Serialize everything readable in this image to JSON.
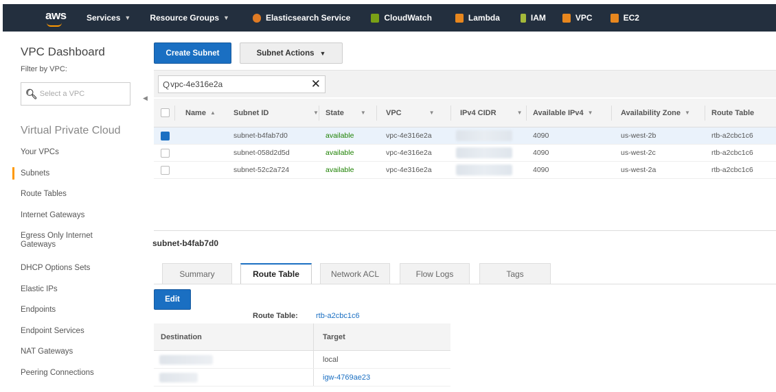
{
  "topnav": {
    "logo": "aws",
    "items": [
      {
        "label": "Services",
        "icon": "none",
        "caret": true
      },
      {
        "label": "Resource Groups",
        "icon": "none",
        "caret": true
      },
      {
        "label": "Elasticsearch Service",
        "icon": "elasticsearch-icon",
        "color": "#e07b24"
      },
      {
        "label": "CloudWatch",
        "icon": "cloudwatch-icon",
        "color": "#7aa116"
      },
      {
        "label": "Lambda",
        "icon": "lambda-icon",
        "color": "#e8871e"
      },
      {
        "label": "IAM",
        "icon": "iam-icon",
        "color": "#a4b93a"
      },
      {
        "label": "VPC",
        "icon": "vpc-icon",
        "color": "#e8871e"
      },
      {
        "label": "EC2",
        "icon": "ec2-icon",
        "color": "#e8871e"
      }
    ]
  },
  "sidebar": {
    "title": "VPC Dashboard",
    "filter_label": "Filter by VPC:",
    "filter_placeholder": "Select a VPC",
    "section_title": "Virtual Private Cloud",
    "items": [
      {
        "label": "Your VPCs"
      },
      {
        "label": "Subnets",
        "active": true
      },
      {
        "label": "Route Tables"
      },
      {
        "label": "Internet Gateways"
      },
      {
        "label": "Egress Only Internet Gateways"
      },
      {
        "label": "DHCP Options Sets"
      },
      {
        "label": "Elastic IPs"
      },
      {
        "label": "Endpoints"
      },
      {
        "label": "Endpoint Services"
      },
      {
        "label": "NAT Gateways"
      },
      {
        "label": "Peering Connections"
      }
    ]
  },
  "toolbar": {
    "create_label": "Create Subnet",
    "actions_label": "Subnet Actions"
  },
  "search": {
    "value": "vpc-4e316e2a"
  },
  "subnets_table": {
    "columns": [
      "Name",
      "Subnet ID",
      "State",
      "VPC",
      "IPv4 CIDR",
      "Available IPv4",
      "Availability Zone",
      "Route Table"
    ],
    "rows": [
      {
        "selected": true,
        "name": "",
        "subnet_id": "subnet-b4fab7d0",
        "state": "available",
        "vpc": "vpc-4e316e2a",
        "available_ipv4": "4090",
        "az": "us-west-2b",
        "route_table": "rtb-a2cbc1c6"
      },
      {
        "selected": false,
        "name": "",
        "subnet_id": "subnet-058d2d5d",
        "state": "available",
        "vpc": "vpc-4e316e2a",
        "available_ipv4": "4090",
        "az": "us-west-2c",
        "route_table": "rtb-a2cbc1c6"
      },
      {
        "selected": false,
        "name": "",
        "subnet_id": "subnet-52c2a724",
        "state": "available",
        "vpc": "vpc-4e316e2a",
        "available_ipv4": "4090",
        "az": "us-west-2a",
        "route_table": "rtb-a2cbc1c6"
      }
    ]
  },
  "detail": {
    "title": "subnet-b4fab7d0",
    "tabs": [
      {
        "label": "Summary",
        "active": false
      },
      {
        "label": "Route Table",
        "active": true
      },
      {
        "label": "Network ACL",
        "active": false
      },
      {
        "label": "Flow Logs",
        "active": false
      },
      {
        "label": "Tags",
        "active": false
      }
    ],
    "edit_label": "Edit",
    "route_table_label": "Route Table:",
    "route_table_value": "rtb-a2cbc1c6",
    "routes": {
      "columns": [
        "Destination",
        "Target"
      ],
      "rows": [
        {
          "target": "local",
          "link": false
        },
        {
          "target": "igw-4769ae23",
          "link": true
        }
      ]
    }
  }
}
